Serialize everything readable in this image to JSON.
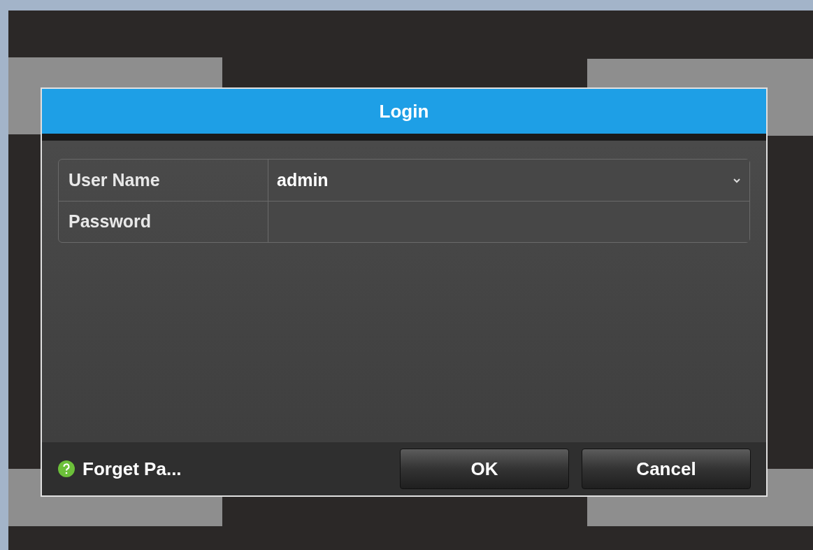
{
  "dialog": {
    "title": "Login",
    "fields": [
      {
        "label": "User Name",
        "value": "admin",
        "kind": "dropdown"
      },
      {
        "label": "Password",
        "kind": "password"
      }
    ],
    "help_link": "Forget Pa...",
    "buttons": [
      "OK",
      "Cancel"
    ]
  }
}
